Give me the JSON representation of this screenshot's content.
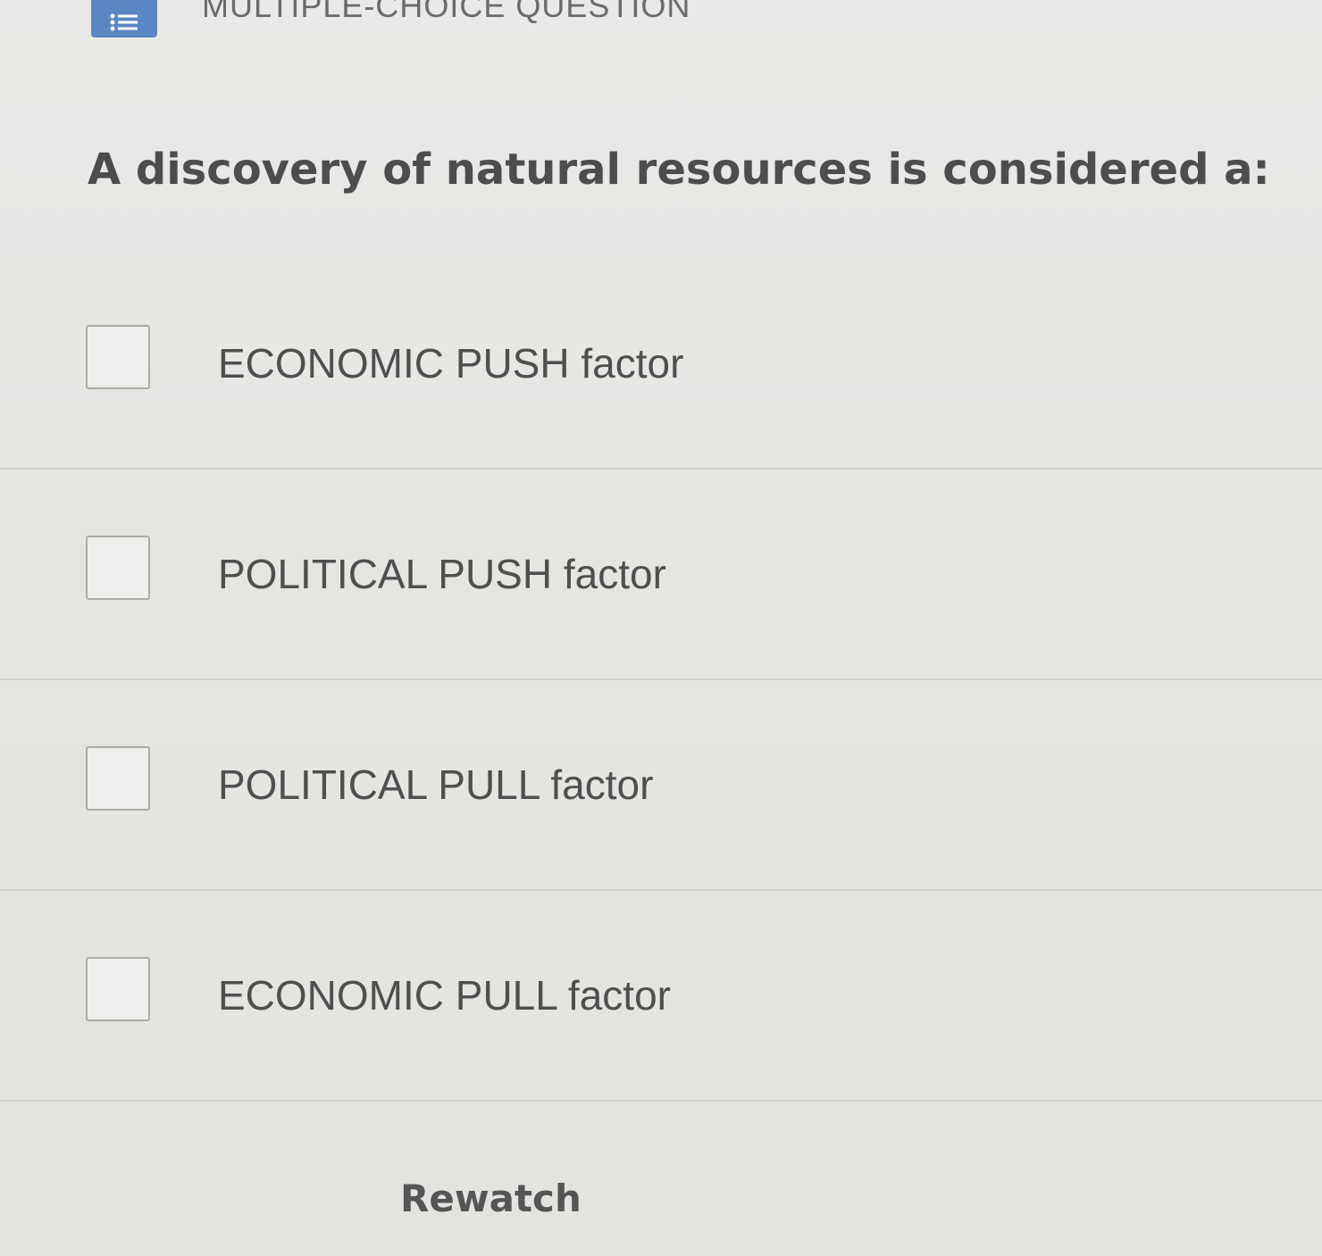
{
  "header": {
    "type_icon": "list-icon",
    "type_label": "MULTIPLE-CHOICE QUESTION",
    "icon_color": "#5b86c4"
  },
  "question": {
    "text": "A discovery of natural resources is considered a:"
  },
  "options": [
    {
      "label": "ECONOMIC PUSH factor",
      "checked": false
    },
    {
      "label": "POLITICAL PUSH factor",
      "checked": false
    },
    {
      "label": "POLITICAL PULL factor",
      "checked": false
    },
    {
      "label": "ECONOMIC PULL factor",
      "checked": false
    }
  ],
  "footer": {
    "rewatch_label": "Rewatch"
  }
}
